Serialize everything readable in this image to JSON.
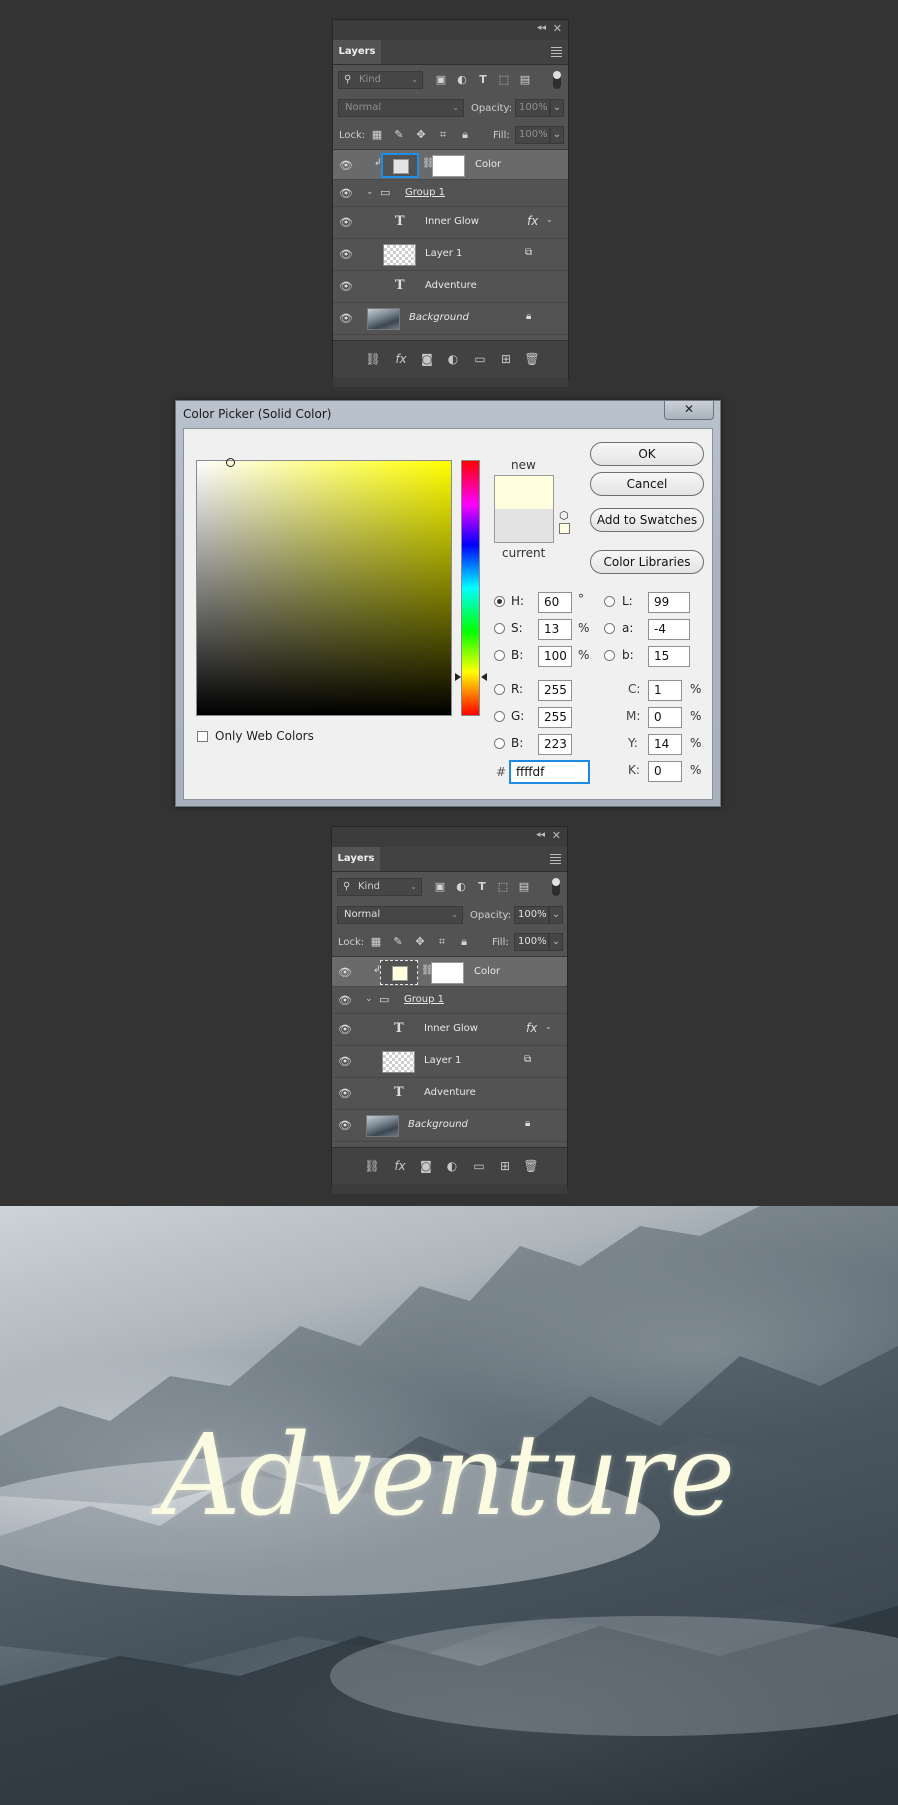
{
  "layers_top": {
    "tab": "Layers",
    "filter_kind": "Kind",
    "blend_mode": "Normal",
    "opacity_label": "Opacity:",
    "opacity_value": "100%",
    "lock_label": "Lock:",
    "fill_label": "Fill:",
    "fill_value": "100%",
    "layers": [
      "Color",
      "Group 1",
      "Inner Glow",
      "Layer 1",
      "Adventure",
      "Background"
    ]
  },
  "color_picker": {
    "title": "Color Picker (Solid Color)",
    "close": "✕",
    "new_label": "new",
    "current_label": "current",
    "buttons": {
      "ok": "OK",
      "cancel": "Cancel",
      "swatches": "Add to Swatches",
      "libraries": "Color Libraries"
    },
    "only_web_colors": "Only Web Colors",
    "fields": {
      "H": "60",
      "S": "13",
      "B_hsb": "100",
      "R": "255",
      "G": "255",
      "B_rgb": "223",
      "L": "99",
      "a": "-4",
      "b": "15",
      "C": "1",
      "M": "0",
      "Y": "14",
      "K": "0"
    },
    "labels": {
      "H": "H:",
      "S": "S:",
      "B_hsb": "B:",
      "R": "R:",
      "G": "G:",
      "B_rgb": "B:",
      "L": "L:",
      "a": "a:",
      "b": "b:",
      "C": "C:",
      "M": "M:",
      "Y": "Y:",
      "K": "K:",
      "deg": "°",
      "pct": "%",
      "hash": "#"
    },
    "hex": "ffffdf",
    "new_color": "#ffffdf",
    "current_color": "#e3e3e3"
  },
  "layers_bottom": {
    "tab": "Layers",
    "filter_kind": "Kind",
    "blend_mode": "Normal",
    "opacity_label": "Opacity:",
    "opacity_value": "100%",
    "lock_label": "Lock:",
    "fill_label": "Fill:",
    "fill_value": "100%",
    "layers": [
      "Color",
      "Group 1",
      "Inner Glow",
      "Layer 1",
      "Adventure",
      "Background"
    ]
  },
  "artwork": {
    "text": "Adventure",
    "text_color": "#fbfbe2"
  }
}
